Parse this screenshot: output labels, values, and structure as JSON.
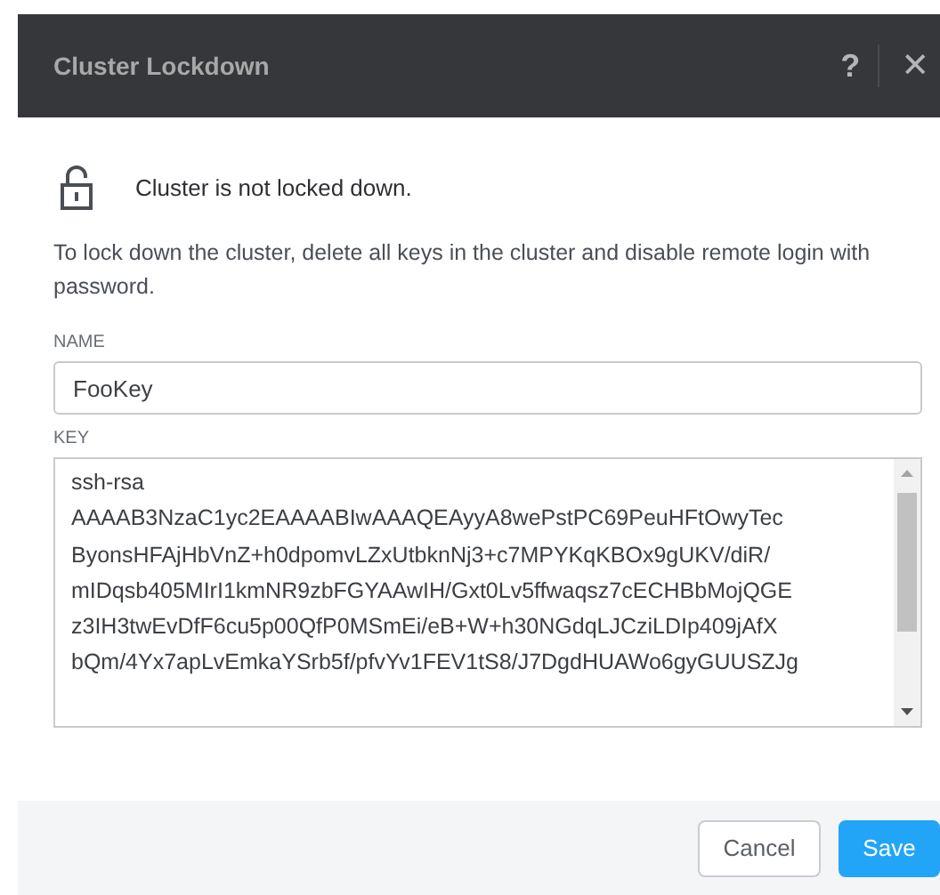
{
  "dialog": {
    "title": "Cluster Lockdown",
    "help": "?",
    "close": "✕"
  },
  "status": {
    "message": "Cluster is not locked down.",
    "locked": false
  },
  "description": "To lock down the cluster, delete all keys in the cluster and disable remote login with password.",
  "name_field": {
    "label": "NAME",
    "value": "FooKey"
  },
  "key_field": {
    "label": "KEY",
    "lines": [
      "ssh-rsa",
      "AAAAB3NzaC1yc2EAAAABIwAAAQEAyyA8wePstPC69PeuHFtOwyTec",
      "ByonsHFAjHbVnZ+h0dpomvLZxUtbknNj3+c7MPYKqKBOx9gUKV/diR/",
      "mIDqsb405MIrI1kmNR9zbFGYAAwIH/Gxt0Lv5ffwaqsz7cECHBbMojQGE",
      "z3IH3twEvDfF6cu5p00QfP0MSmEi/eB+W+h30NGdqLJCziLDIp409jAfX",
      "bQm/4Yx7apLvEmkaYSrb5f/pfvYv1FEV1tS8/J7DgdHUAWo6gyGUUSZJg"
    ]
  },
  "buttons": [
    {
      "label": "Cancel",
      "kind": "secondary"
    },
    {
      "label": "Save",
      "kind": "primary"
    }
  ]
}
